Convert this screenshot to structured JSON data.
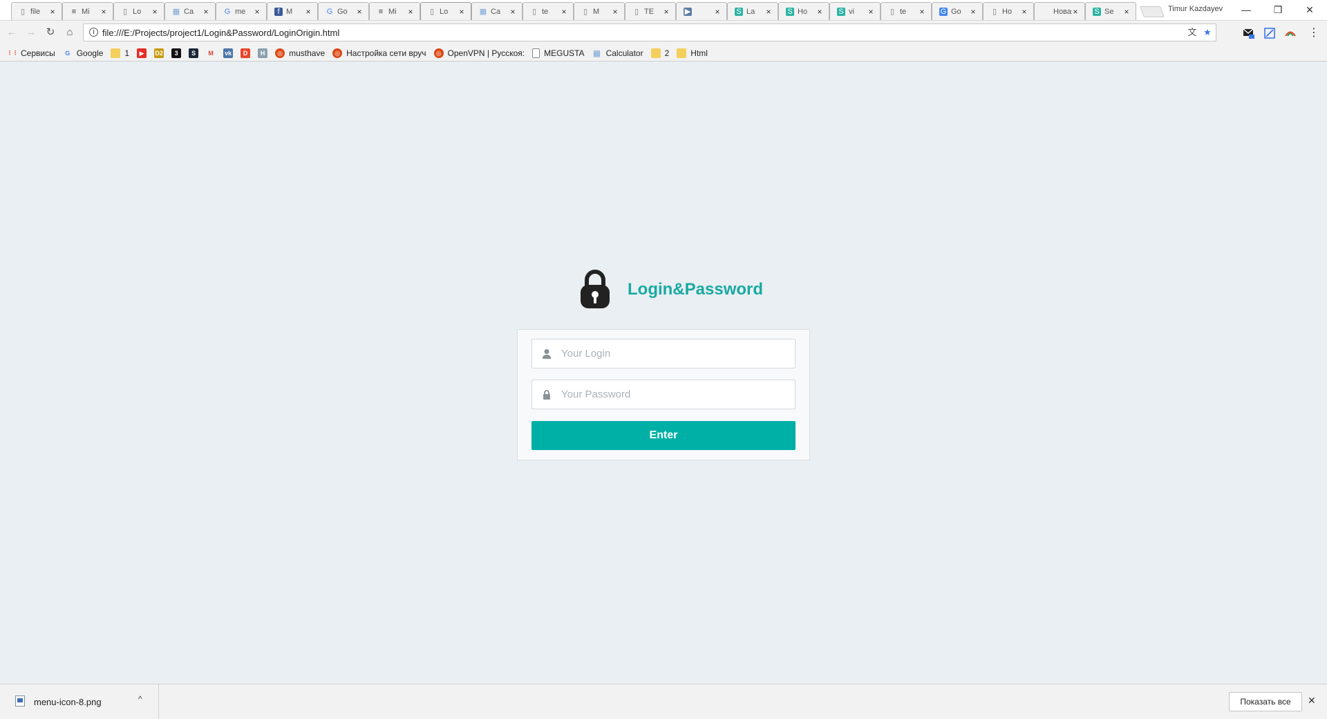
{
  "tabs": [
    {
      "title": "file",
      "icon": "page-icon",
      "active": false
    },
    {
      "title": "Mi",
      "icon": "menu-icon",
      "active": false
    },
    {
      "title": "Lo",
      "icon": "page-icon",
      "active": false
    },
    {
      "title": "Ca",
      "icon": "sheet-icon",
      "active": false
    },
    {
      "title": "me",
      "icon": "google-icon",
      "active": false
    },
    {
      "title": "M",
      "icon": "facebook-icon",
      "active": false
    },
    {
      "title": "Go",
      "icon": "google-icon",
      "active": false
    },
    {
      "title": "Mi",
      "icon": "menu-icon",
      "active": false
    },
    {
      "title": "Lo",
      "icon": "page-icon",
      "active": true
    },
    {
      "title": "Ca",
      "icon": "sheet-icon",
      "active": false
    },
    {
      "title": "te",
      "icon": "page-icon",
      "active": false
    },
    {
      "title": "M",
      "icon": "page-icon",
      "active": false
    },
    {
      "title": "TE",
      "icon": "page-icon",
      "active": false
    },
    {
      "title": "",
      "icon": "media-icon",
      "active": false
    },
    {
      "title": "La",
      "icon": "s-icon",
      "active": false
    },
    {
      "title": "Ho",
      "icon": "s-icon",
      "active": false
    },
    {
      "title": "vi",
      "icon": "s-icon",
      "active": false
    },
    {
      "title": "te",
      "icon": "page-icon",
      "active": false
    },
    {
      "title": "Go",
      "icon": "translate-icon",
      "active": false
    },
    {
      "title": "Ho",
      "icon": "page-icon",
      "active": false
    },
    {
      "title": "Новая",
      "icon": "none",
      "active": false
    },
    {
      "title": "Se",
      "icon": "s-icon",
      "active": false
    }
  ],
  "window": {
    "profile_name": "Timur Kazdayev",
    "minimize": "—",
    "restore": "❐",
    "close": "✕"
  },
  "toolbar": {
    "back": "←",
    "forward": "→",
    "reload": "↻",
    "home": "⌂",
    "url": "file:///E:/Projects/project1/Login&Password/LoginOrigin.html",
    "translate": "文",
    "bookmark_star": "★",
    "menu": "⋮"
  },
  "bookmarks": [
    {
      "label": "Сервисы",
      "icon": "apps-icon",
      "color": "#e0531f"
    },
    {
      "label": "Google",
      "icon": "google-icon",
      "color": "#4285f4"
    },
    {
      "label": "1",
      "icon": "folder-icon",
      "color": "#f4cf5c"
    },
    {
      "label": "",
      "icon": "youtube-icon",
      "color": "#e52d27"
    },
    {
      "label": "",
      "icon": "d2-icon",
      "color": "#c79a10"
    },
    {
      "label": "",
      "icon": "3-icon",
      "color": "#111111"
    },
    {
      "label": "",
      "icon": "steam-icon",
      "color": "#1b2838"
    },
    {
      "label": "",
      "icon": "gmail-icon",
      "color": "#d44638"
    },
    {
      "label": "",
      "icon": "vk-icon",
      "color": "#4a76a8"
    },
    {
      "label": "",
      "icon": "d-icon",
      "color": "#e8462c"
    },
    {
      "label": "",
      "icon": "h-icon",
      "color": "#8ba0ae"
    },
    {
      "label": "musthave",
      "icon": "ubuntu-icon",
      "color": "#dd4814"
    },
    {
      "label": "Настройка сети вруч",
      "icon": "ubuntu-icon",
      "color": "#dd4814"
    },
    {
      "label": "OpenVPN | Русскоя:",
      "icon": "ubuntu-icon",
      "color": "#dd4814"
    },
    {
      "label": "MEGUSTA",
      "icon": "page-icon",
      "color": "#ffffff"
    },
    {
      "label": "Calculator",
      "icon": "sheet-icon",
      "color": "#7aa6d6"
    },
    {
      "label": "2",
      "icon": "folder-icon",
      "color": "#f4cf5c"
    },
    {
      "label": "Html",
      "icon": "folder-icon",
      "color": "#f4cf5c"
    }
  ],
  "login": {
    "title": "Login&Password",
    "login_placeholder": "Your Login",
    "password_placeholder": "Your Password",
    "enter_label": "Enter",
    "accent_color": "#00b0a6",
    "title_color": "#1aa9a2"
  },
  "downloads": {
    "filename": "menu-icon-8.png",
    "caret": "^",
    "show_all": "Показать все",
    "close": "✕"
  }
}
